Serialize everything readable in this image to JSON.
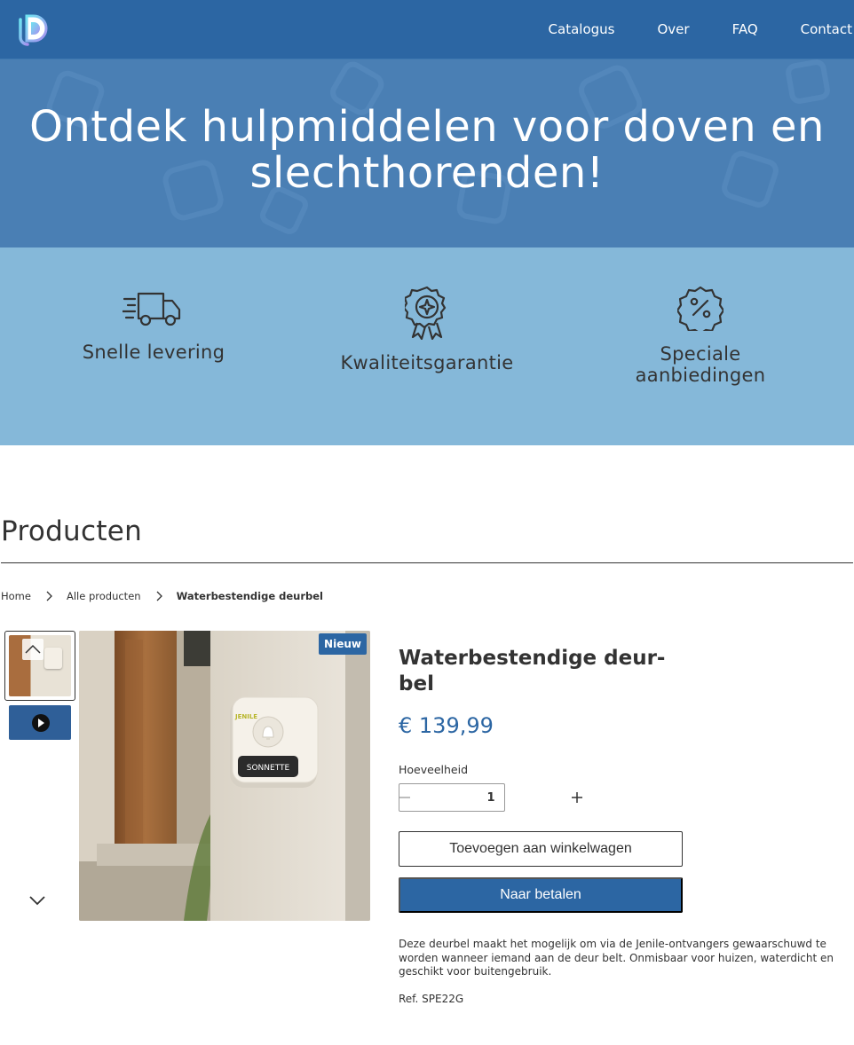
{
  "nav": {
    "logo_icon": "letter-d-logo",
    "links": [
      "Catalogus",
      "Over",
      "FAQ",
      "Contact"
    ]
  },
  "hero": {
    "title": "Ontdek hulpmiddelen voor doven en slechthorenden!"
  },
  "features": [
    {
      "icon": "delivery-truck-icon",
      "label": "Snelle levering"
    },
    {
      "icon": "award-ribbon-icon",
      "label": "Kwaliteitsgarantie"
    },
    {
      "icon": "percent-badge-icon",
      "label": "Speciale aanbiedingen"
    }
  ],
  "section": {
    "title": "Producten"
  },
  "breadcrumb": {
    "items": [
      "Home",
      "Alle producten"
    ],
    "current": "Waterbestendige deurbel"
  },
  "product": {
    "badge": "Nieuw",
    "title": "Waterbestendige deur-bel",
    "title_line1": "Waterbestendige deur-",
    "title_line2": "bel",
    "price": "€ 139,99",
    "quantity_label": "Hoeveelheid",
    "quantity": "1",
    "add_to_cart": "Toevoegen aan winkelwagen",
    "checkout": "Naar betalen",
    "description": "Deze deurbel maakt het mogelijk om via de Jenile-ontvangers gewaarschuwd te worden wanneer iemand aan de deur belt. Onmisbaar voor huizen, waterdicht en geschikt voor buitengebruik.",
    "reference": "Ref. SPE22G",
    "image_brand": "JENILE",
    "image_label": "SONNETTE"
  },
  "colors": {
    "primary": "#2c66a3",
    "hero_bg": "#4a7fb4",
    "features_bg": "#85b8d9",
    "text": "#333333"
  }
}
